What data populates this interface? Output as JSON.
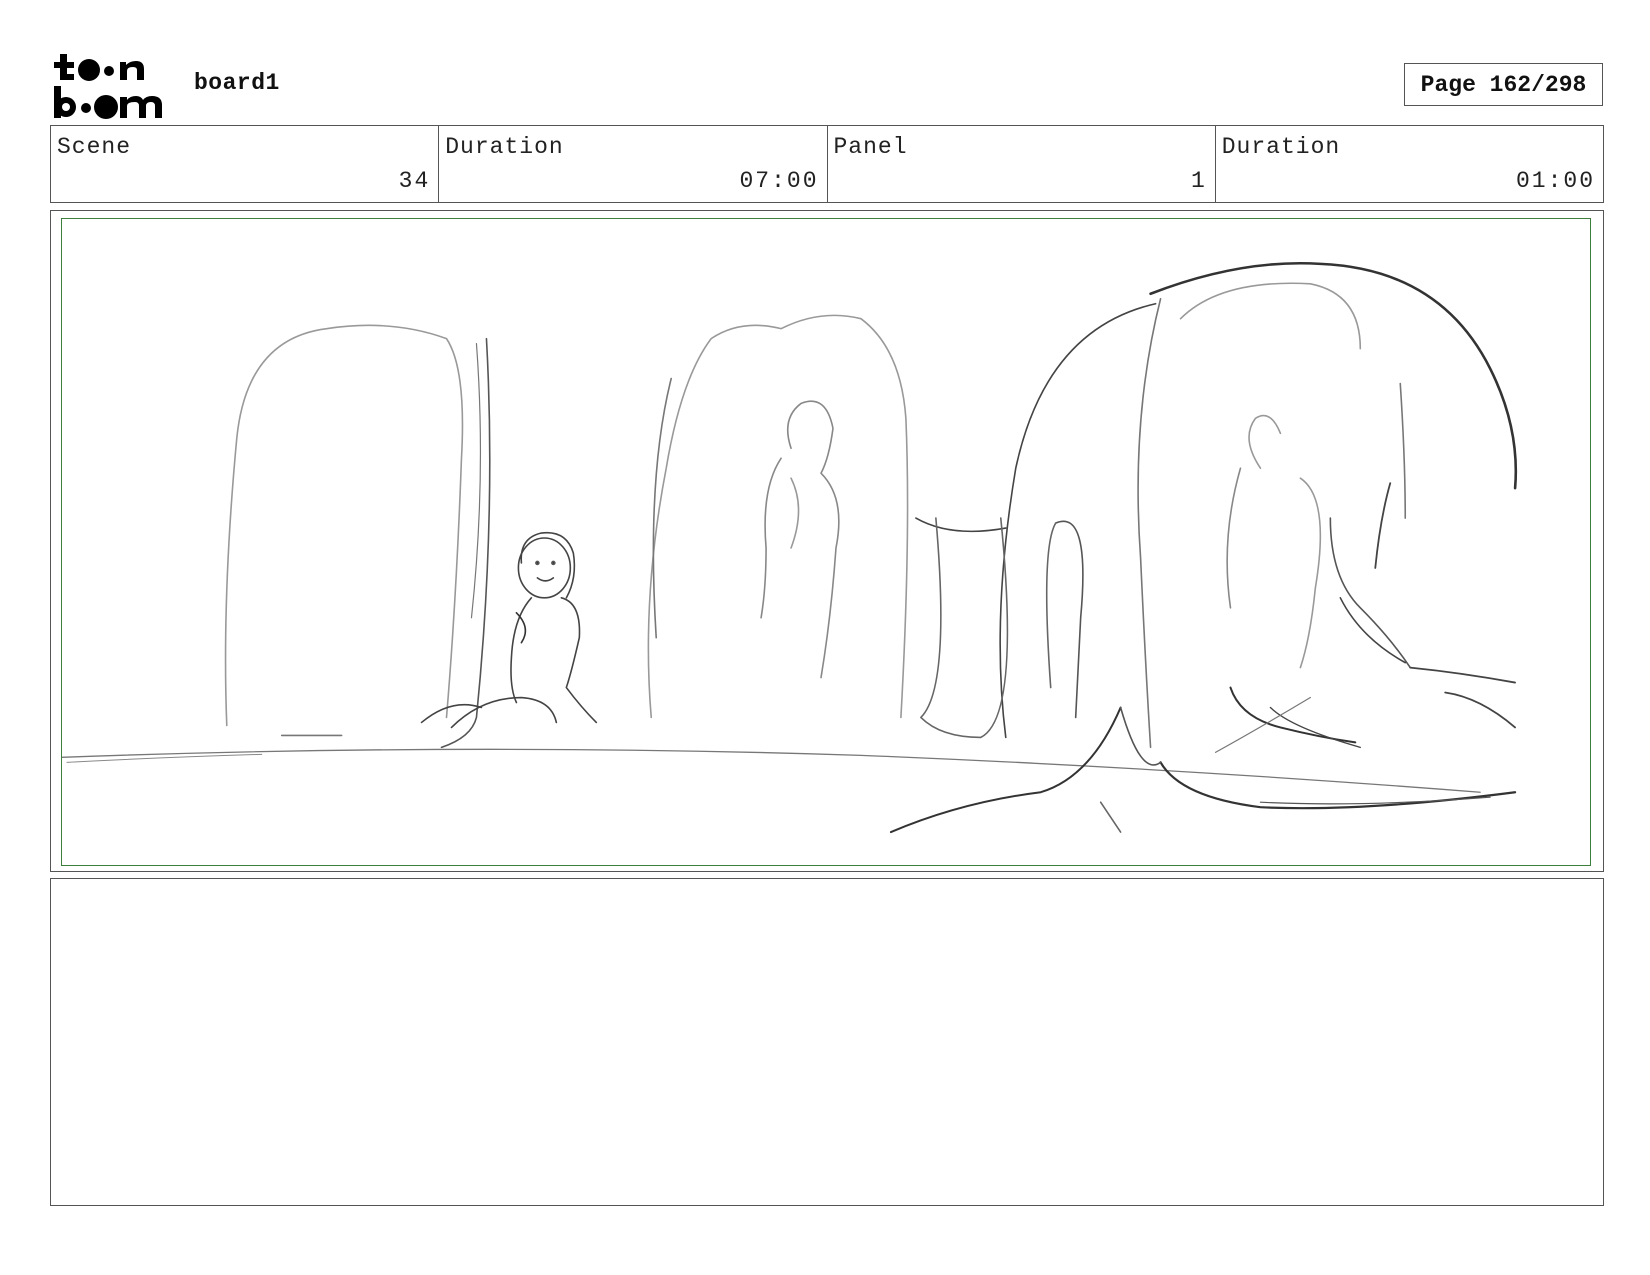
{
  "header": {
    "logo_text": "toon boom",
    "board_title": "board1",
    "page_label": "Page 162/298"
  },
  "info": {
    "scene_label": "Scene",
    "scene_value": "34",
    "scene_duration_label": "Duration",
    "scene_duration_value": "07:00",
    "panel_label": "Panel",
    "panel_value": "1",
    "panel_duration_label": "Duration",
    "panel_duration_value": "01:00"
  },
  "panel": {
    "frame_color": "#3e7f3e",
    "sketch_color": "#444444"
  },
  "notes": {
    "text": ""
  }
}
